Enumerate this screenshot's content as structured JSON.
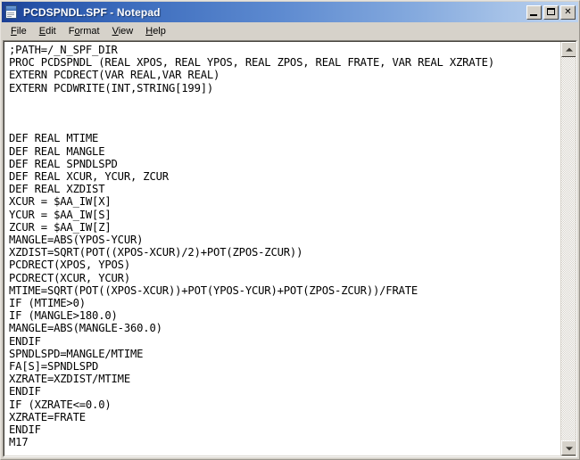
{
  "window": {
    "title": "PCDSPNDL.SPF - Notepad",
    "icon": "notepad-document-icon",
    "titlebar_gradient_start": "#1c3f93",
    "titlebar_gradient_end": "#bcd2ee",
    "frame_color": "#d6d2ca",
    "controls": [
      {
        "name": "minimize",
        "label": "_"
      },
      {
        "name": "maximize",
        "label": "□"
      },
      {
        "name": "close",
        "label": "✕"
      }
    ]
  },
  "menubar": {
    "items": [
      {
        "name": "file",
        "label": "File",
        "accesskey": "F"
      },
      {
        "name": "edit",
        "label": "Edit",
        "accesskey": "E"
      },
      {
        "name": "format",
        "label": "Format",
        "accesskey": "o"
      },
      {
        "name": "view",
        "label": "View",
        "accesskey": "V"
      },
      {
        "name": "help",
        "label": "Help",
        "accesskey": "H"
      }
    ]
  },
  "editor": {
    "text_color": "#000000",
    "background_color": "#ffffff",
    "content": ";PATH=/_N_SPF_DIR\nPROC PCDSPNDL (REAL XPOS, REAL YPOS, REAL ZPOS, REAL FRATE, VAR REAL XZRATE)\nEXTERN PCDRECT(VAR REAL,VAR REAL)\nEXTERN PCDWRITE(INT,STRING[199])\n\n\n\nDEF REAL MTIME\nDEF REAL MANGLE\nDEF REAL SPNDLSPD\nDEF REAL XCUR, YCUR, ZCUR\nDEF REAL XZDIST\nXCUR = $AA_IW[X]\nYCUR = $AA_IW[S]\nZCUR = $AA_IW[Z]\nMANGLE=ABS(YPOS-YCUR)\nXZDIST=SQRT(POT((XPOS-XCUR)/2)+POT(ZPOS-ZCUR))\nPCDRECT(XPOS, YPOS)\nPCDRECT(XCUR, YCUR)\nMTIME=SQRT(POT((XPOS-XCUR))+POT(YPOS-YCUR)+POT(ZPOS-ZCUR))/FRATE\nIF (MTIME>0)\nIF (MANGLE>180.0)\nMANGLE=ABS(MANGLE-360.0)\nENDIF\nSPNDLSPD=MANGLE/MTIME\nFA[S]=SPNDLSPD\nXZRATE=XZDIST/MTIME\nENDIF\nIF (XZRATE<=0.0)\nXZRATE=FRATE\nENDIF\nM17"
  },
  "scrollbar": {
    "up_arrow": "scroll-up-arrow",
    "down_arrow": "scroll-down-arrow",
    "track_style": "dithered"
  }
}
